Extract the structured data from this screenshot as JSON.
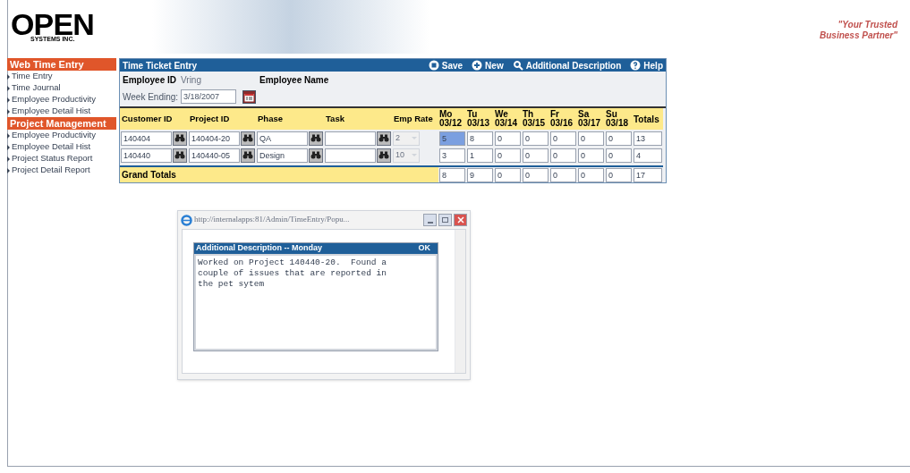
{
  "logo": {
    "word": "OPEN",
    "subtitle": "SYSTEMS INC."
  },
  "tagline": [
    "\"Your Trusted",
    "Business Partner\""
  ],
  "sidebar": {
    "sections": [
      {
        "title": "Web Time Entry",
        "items": [
          "Time Entry",
          "Time Journal",
          "Employee Productivity",
          "Employee Detail Hist"
        ]
      },
      {
        "title": "Project Management",
        "items": [
          "Employee Productivity",
          "Employee Detail Hist",
          "Project Status Report",
          "Project Detail Report"
        ]
      }
    ]
  },
  "ticket": {
    "title": "Time Ticket Entry",
    "actions": [
      {
        "label": "Save",
        "kind": "save"
      },
      {
        "label": "New",
        "kind": "new"
      },
      {
        "label": "Additional Description",
        "kind": "search"
      },
      {
        "label": "Help",
        "kind": "help"
      }
    ],
    "employee_id_label": "Employee ID",
    "employee_id": "Vring",
    "employee_name_label": "Employee Name",
    "week_ending_label": "Week Ending:",
    "week_ending": "3/18/2007",
    "columns": [
      "Customer ID",
      "Project ID",
      "Phase",
      "Task",
      "Emp Rate"
    ],
    "days": [
      {
        "day": "Mo",
        "date": "03/12"
      },
      {
        "day": "Tu",
        "date": "03/13"
      },
      {
        "day": "We",
        "date": "03/14"
      },
      {
        "day": "Th",
        "date": "03/15"
      },
      {
        "day": "Fr",
        "date": "03/16"
      },
      {
        "day": "Sa",
        "date": "03/17"
      },
      {
        "day": "Su",
        "date": "03/18"
      }
    ],
    "totals_label": "Totals",
    "rows": [
      {
        "customer_id": "140404",
        "project_id": "140404-20",
        "phase": "QA",
        "emp_rate": "2",
        "emp_rate_disabled": true,
        "hours": [
          {
            "value": "5",
            "selected": true
          },
          {
            "value": "8",
            "selected": false
          },
          {
            "value": "0",
            "selected": false
          },
          {
            "value": "0",
            "selected": false
          },
          {
            "value": "0",
            "selected": false
          },
          {
            "value": "0",
            "selected": false
          },
          {
            "value": "0",
            "selected": false
          }
        ],
        "total": "13"
      },
      {
        "customer_id": "140440",
        "project_id": "140440-05",
        "phase": "Design",
        "emp_rate": "10",
        "emp_rate_disabled": true,
        "hours": [
          {
            "value": "3",
            "selected": false
          },
          {
            "value": "1",
            "selected": false
          },
          {
            "value": "0",
            "selected": false
          },
          {
            "value": "0",
            "selected": false
          },
          {
            "value": "0",
            "selected": false
          },
          {
            "value": "0",
            "selected": false
          },
          {
            "value": "0",
            "selected": false
          }
        ],
        "total": "4"
      }
    ],
    "grand_totals": {
      "label": "Grand Totals",
      "hours": [
        "8",
        "9",
        "0",
        "0",
        "0",
        "0",
        "0"
      ],
      "total": "17"
    }
  },
  "popup": {
    "url": "http://internalapps:81/Admin/TimeEntry/Popu...",
    "header": "Additional Description -- Monday",
    "ok": "OK",
    "text": "Worked on Project 140440-20.  Found a couple of issues that are reported in the pet sytem"
  }
}
